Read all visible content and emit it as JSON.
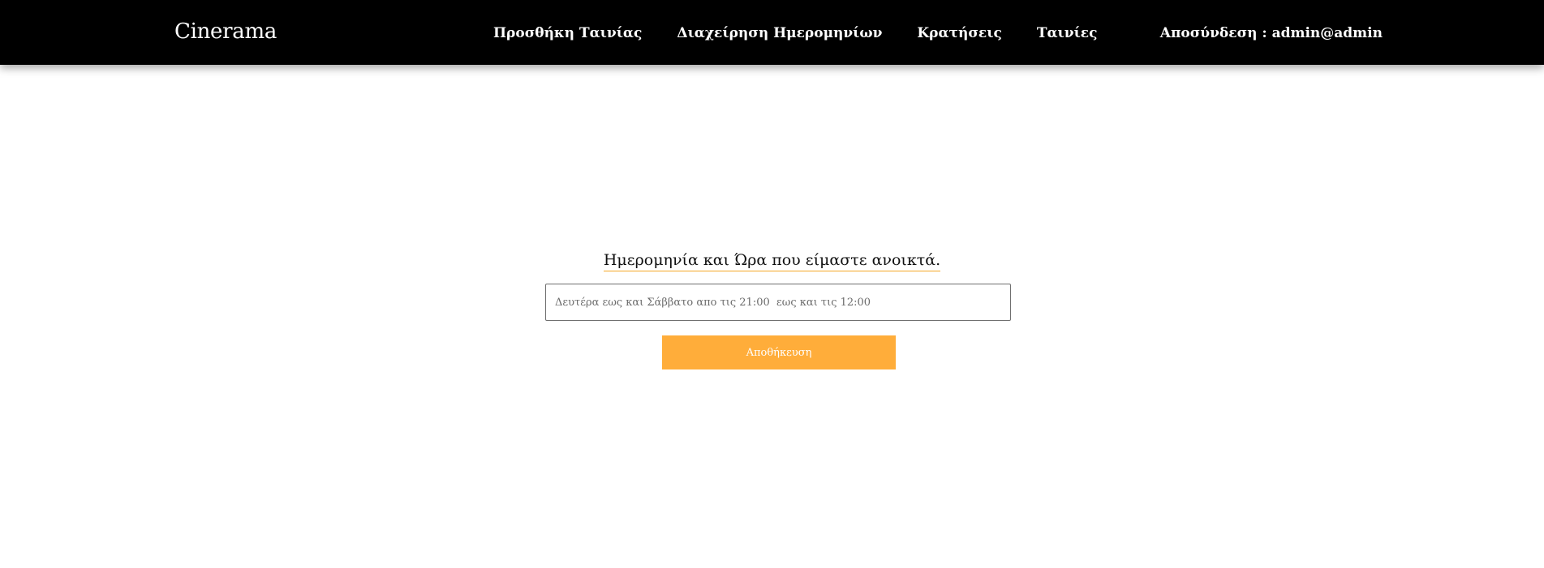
{
  "navbar": {
    "brand": "Cinerama",
    "links": [
      {
        "label": "Προσθήκη Ταινίας"
      },
      {
        "label": "Διαχείρηση Ημερομηνίων"
      },
      {
        "label": "Κρατήσεις"
      },
      {
        "label": "Ταινίες"
      }
    ],
    "logout_label": "Αποσύνδεση : admin@admin"
  },
  "form": {
    "title": "Ημερομηνία και Ώρα που είμαστε ανοικτά.",
    "hours_placeholder": "Δευτέρα εως και Σάββατο απο τις 21:00  εως και τις 12:00",
    "hours_value": "",
    "save_label": "Αποθήκευση"
  },
  "colors": {
    "navbar_bg": "#000000",
    "accent": "#ffad3a",
    "title_underline": "#f5a623"
  }
}
